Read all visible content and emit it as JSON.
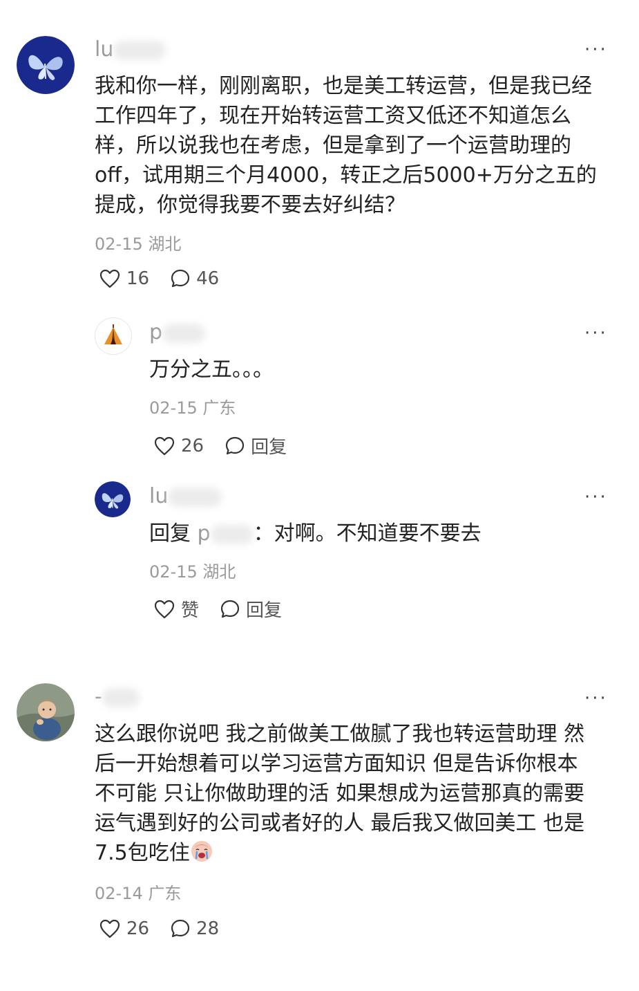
{
  "comments": [
    {
      "username": "lu",
      "text": "我和你一样，刚刚离职，也是美工转运营，但是我已经工作四年了，现在开始转运营工资又低还不知道怎么样，所以说我也在考虑，但是拿到了一个运营助理的off，试用期三个月4000，转正之后5000+万分之五的提成，你觉得我要不要去好纠结？",
      "lines": [
        "我和你一样，刚刚离职，也是美工转运营，但是我已经",
        "工作四年了，现在开始转运营工资又低还不知道怎么",
        "样，所以说我也在考虑，但是拿到了一个运营助理的",
        "off，试用期三个月4000，转正之后5000+万分之五的",
        "提成，你觉得我要不要去好纠结？"
      ],
      "date": "02-15",
      "location": "湖北",
      "likes": "16",
      "comments_count": "46",
      "more": "···",
      "replies": [
        {
          "username": "p",
          "text": "万分之五。。。",
          "date": "02-15",
          "location": "广东",
          "likes": "26",
          "reply_label": "回复",
          "more": "···"
        },
        {
          "username": "lu",
          "reply_prefix": "回复",
          "reply_to": "p",
          "text": "：对啊。不知道要不要去",
          "date": "02-15",
          "location": "湖北",
          "likes": "赞",
          "reply_label": "回复",
          "more": "···"
        }
      ]
    },
    {
      "username": "-",
      "lines": [
        "这么跟你说吧 我之前做美工做腻了我也转运营助理 然",
        "后一开始想着可以学习运营方面知识 但是告诉你根本",
        "不可能 只让你做助理的活 如果想成为运营那真的需要",
        "运气遇到好的公司或者好的人 最后我又做回美工 也是",
        "7.5包吃住"
      ],
      "date": "02-14",
      "location": "广东",
      "likes": "26",
      "comments_count": "28",
      "more": "···"
    }
  ],
  "icons": {
    "like": "heart-outline-icon",
    "comment": "speech-bubble-icon",
    "more": "more-dots-icon",
    "emoji": "crying-face-emoji"
  },
  "colors": {
    "text": "#222222",
    "meta": "#9a9a9a",
    "avatar_butterfly_bg": "#1a2a8c"
  }
}
